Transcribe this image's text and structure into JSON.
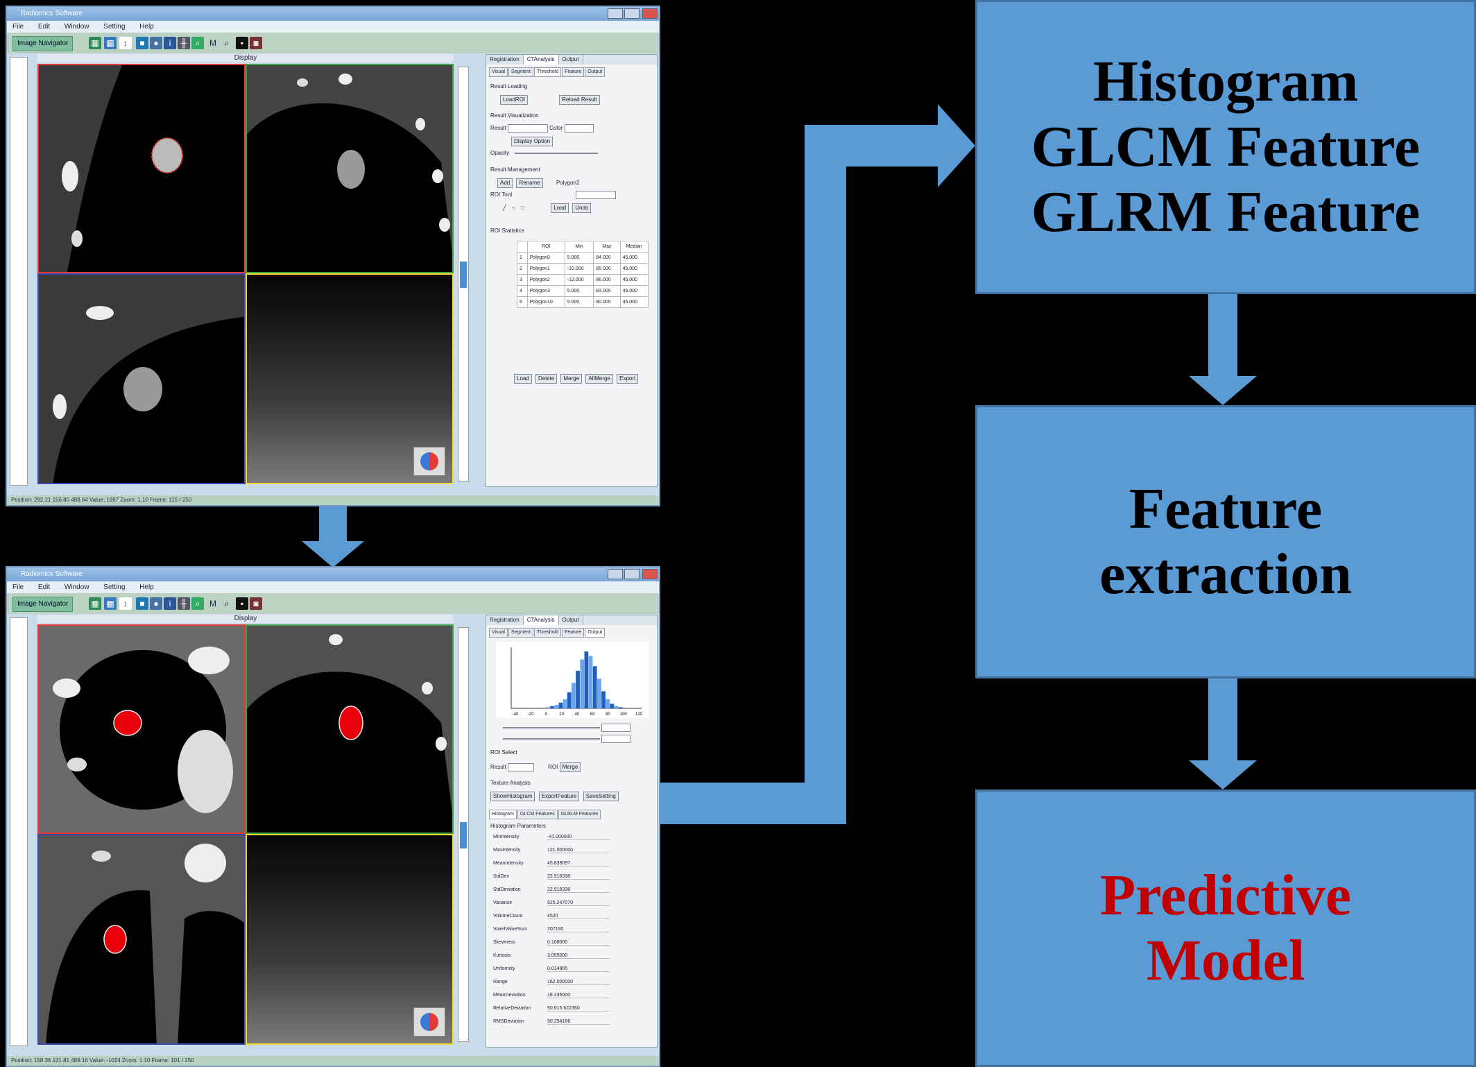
{
  "flow": {
    "features_box": {
      "lines": [
        "Histogram",
        "GLCM Feature",
        "GLRM Feature"
      ]
    },
    "extraction_box": {
      "lines": [
        "Feature",
        "extraction"
      ]
    },
    "model_box": {
      "lines": [
        "Predictive",
        "Model"
      ],
      "color": "#c00000"
    },
    "box_color": "#5b9bd5",
    "arrow_color": "#5b9bd5"
  },
  "window_top": {
    "title": "Radiomics Software",
    "menu": [
      "File",
      "Edit",
      "Window",
      "Setting",
      "Help"
    ],
    "toolbar_label": "Image Navigator",
    "display_label": "Display",
    "tabs": [
      "Registration",
      "CTAnalysis",
      "Output"
    ],
    "subtabs": [
      "Visual",
      "Segment",
      "Threshold",
      "Feature",
      "Output"
    ],
    "sections": {
      "threshold": "Result Loading",
      "load_btn": "LoadROI",
      "reload_btn": "Reload Result",
      "visualization": "Result Visualization",
      "result_label": "Result",
      "color_label": "Color",
      "display_option": "Display Option",
      "opacity_label": "Opacity",
      "management": "Result Management",
      "add_btn": "Add",
      "rename_btn": "Rename",
      "roi_tool": "ROI Tool",
      "polygon_label": "Polygon2",
      "roi_statistics": "ROI Statistics",
      "load_btn2": "Load",
      "undo_btn": "Undo"
    },
    "roi_table": {
      "headers": [
        "ROI",
        "Min",
        "Max",
        "Median"
      ],
      "rows": [
        [
          "Polygon0",
          "5.000",
          "84.000",
          "45.000"
        ],
        [
          "Polygon1",
          "-10.000",
          "85.000",
          "45.000"
        ],
        [
          "Polygon2",
          "-12.000",
          "86.000",
          "45.000"
        ],
        [
          "Polygon3",
          "5.000",
          "83.000",
          "45.000"
        ],
        [
          "Polygon10",
          "5.000",
          "80.000",
          "45.000"
        ]
      ]
    },
    "bottom_buttons": [
      "Load",
      "Delete",
      "Merge",
      "AllMerge",
      "Export"
    ],
    "status": "Position: 292.21  156.80  488.64  Value: 1997  Zoom: 1.10  Frame: 115 / 250"
  },
  "window_bottom": {
    "title": "Radiomics Software",
    "menu": [
      "File",
      "Edit",
      "Window",
      "Setting",
      "Help"
    ],
    "toolbar_label": "Image Navigator",
    "display_label": "Display",
    "tabs": [
      "Registration",
      "CTAnalysis",
      "Output"
    ],
    "subtabs": [
      "Visual",
      "Segment",
      "Threshold",
      "Feature",
      "Output"
    ],
    "histogram": {
      "x_ticks": [
        "-40",
        "-20",
        "0",
        "20",
        "40",
        "60",
        "80",
        "100",
        "120"
      ],
      "bins": [
        0.02,
        0.04,
        0.06,
        0.1,
        0.16,
        0.28,
        0.45,
        0.66,
        0.86,
        1.0,
        0.92,
        0.74,
        0.52,
        0.3,
        0.16,
        0.08,
        0.04,
        0.02
      ]
    },
    "controls": {
      "roi_select": "ROI Select",
      "result_label": "Result",
      "roi_label": "ROI",
      "roi_value": "Merge",
      "texture": "Texture Analysis",
      "btn1": "ShowHistogram",
      "btn2": "ExportFeature",
      "btn3": "SaveSetting"
    },
    "feature_tabs": [
      "Histogram",
      "GLCM Features",
      "GLRLM Features"
    ],
    "params_title": "Histogram Parameters",
    "params": [
      [
        "MinIntensity",
        "-41.000000"
      ],
      [
        "MaxIntensity",
        "121.000000"
      ],
      [
        "MeanIntensity",
        "45.838097"
      ],
      [
        "StdDev",
        "22.918338"
      ],
      [
        "StdDeviation",
        "22.918338"
      ],
      [
        "Variance",
        "525.247070"
      ],
      [
        "VolumeCount",
        "4520"
      ],
      [
        "VoxelValueSum",
        "207190"
      ],
      [
        "Skewness",
        "0.108000"
      ],
      [
        "Kurtosis",
        "3.055000"
      ],
      [
        "Uniformity",
        "0.014865"
      ],
      [
        "Range",
        "162.000000"
      ],
      [
        "MeanDeviation",
        "18.235000"
      ],
      [
        "RelativeDeviation",
        "50.015.622360"
      ],
      [
        "RMSDeviation",
        "50.254166"
      ]
    ],
    "status": "Position: 158.36  131.81  489.16  Value: -1024  Zoom: 1.10  Frame: 101 / 250"
  }
}
